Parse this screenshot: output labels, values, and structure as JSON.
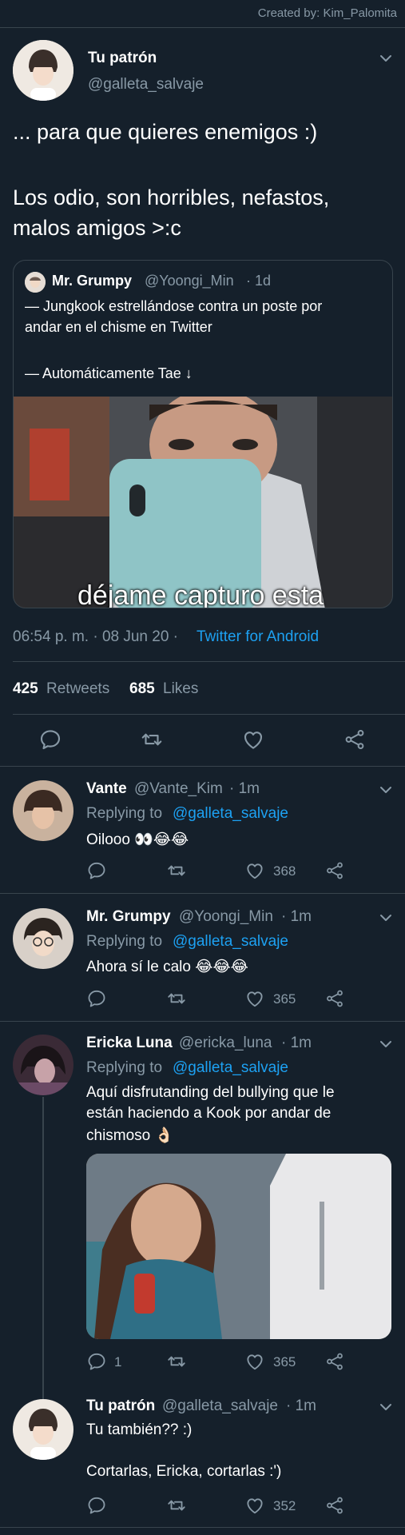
{
  "watermark": "Created by: Kim_Palomita",
  "main_tweet": {
    "display_name": "Tu patrón",
    "handle": "@galleta_salvaje",
    "text_line1": "... para que quieres enemigos :)",
    "text_line2": "Los odio, son horribles, nefastos,",
    "text_line3": "malos amigos >:c",
    "quoted": {
      "display_name": "Mr. Grumpy",
      "handle": "@Yoongi_Min",
      "time": "· 1d",
      "line1": "— Jungkook estrellándose contra un poste por",
      "line2": "andar en el chisme en Twitter",
      "line3": "— Automáticamente Tae ↓",
      "caption": "déjame capturo esta"
    },
    "timestamp": "06:54 p. m. · 08 Jun 20 ·",
    "source": "Twitter for Android",
    "retweets_count": "425",
    "retweets_label": "Retweets",
    "likes_count": "685",
    "likes_label": "Likes"
  },
  "replies": [
    {
      "display_name": "Vante",
      "handle": "@Vante_Kim",
      "time": "· 1m",
      "replying_label": "Replying to",
      "replying_to": "@galleta_salvaje",
      "text": "Oilooo 👀😂😂",
      "likes": "368"
    },
    {
      "display_name": "Mr. Grumpy",
      "handle": "@Yoongi_Min",
      "time": "· 1m",
      "replying_label": "Replying to",
      "replying_to": "@galleta_salvaje",
      "text": "Ahora sí le calo 😂😂😂",
      "likes": "365"
    },
    {
      "display_name": "Ericka Luna",
      "handle": "@ericka_luna",
      "time": "· 1m",
      "replying_label": "Replying to",
      "replying_to": "@galleta_salvaje",
      "text_line1": "Aquí disfrutanding del bullying que le",
      "text_line2": "están haciendo a Kook por andar de",
      "text_line3": "chismoso 👌🏻",
      "replies": "1",
      "likes": "365"
    },
    {
      "display_name": "Tu patrón",
      "handle": "@galleta_salvaje",
      "time": "· 1m",
      "text_line1": "Tu también?? :)",
      "text_line2": "Cortarlas, Ericka, cortarlas :')",
      "likes": "352"
    }
  ],
  "icons": {
    "reply": "reply-icon",
    "retweet": "retweet-icon",
    "like": "heart-icon",
    "share": "share-icon",
    "more": "chevron-down-icon"
  },
  "colors": {
    "background": "#15202b",
    "divider": "#38444d",
    "muted": "#8899a6",
    "link": "#1da1f2"
  }
}
